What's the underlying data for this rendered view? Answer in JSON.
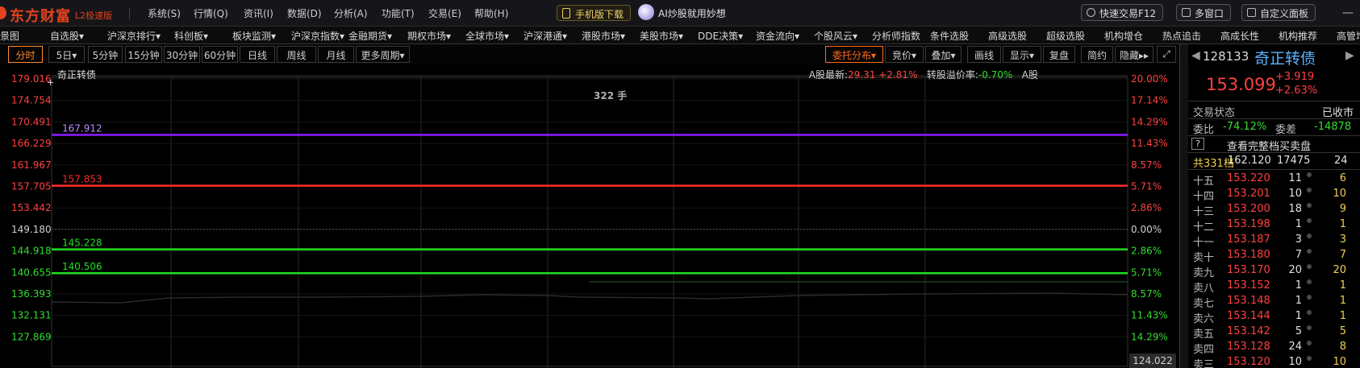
{
  "app": {
    "brand": "东方财富",
    "edition": "L2极速版",
    "menus": [
      "系统(S)",
      "行情(Q)",
      "资讯(I)",
      "数据(D)",
      "分析(A)",
      "功能(T)",
      "交易(E)",
      "帮助(H)"
    ],
    "mobile_download": "手机版下载",
    "ai_slogan": "AI炒股就用妙想",
    "quick_trade": "快速交易F12",
    "multi_window": "多窗口",
    "custom_panel": "自定义面板"
  },
  "nav": {
    "items": [
      "全景图",
      "自选股",
      "沪深京排行",
      "科创板",
      "板块监测",
      "沪深京指数",
      "金融期货",
      "期权市场",
      "全球市场",
      "沪深港通",
      "港股市场",
      "美股市场",
      "DDE决策",
      "资金流向",
      "个股风云",
      "分析师指数",
      "条件选股",
      "高级选股",
      "超级选股",
      "机构增仓",
      "热点追击",
      "高成长性",
      "机构推荐",
      "高管增持"
    ],
    "dropdown_marker": "▾"
  },
  "toolbar": {
    "periods": [
      "分时",
      "5日",
      "5分钟",
      "15分钟",
      "30分钟",
      "60分钟",
      "日线",
      "周线",
      "月线",
      "更多周期"
    ],
    "active_period": "分时",
    "right_buttons": [
      "委托分布",
      "竞价",
      "叠加",
      "画线",
      "显示",
      "复盘",
      "简约",
      "隐藏"
    ]
  },
  "chart": {
    "stock_name": "奇正转债",
    "a_share_last_label": "A股最新:",
    "a_share_last": "29.31",
    "a_share_change": "+2.81%",
    "premium_label": "转股溢价率:",
    "premium": "-0.70%",
    "a_share_tag": "A股",
    "volume_label": "322 手",
    "bottom_price": "124.022",
    "left_axis": [
      "179.016",
      "174.754",
      "170.491",
      "166.229",
      "161.967",
      "157.705",
      "153.442",
      "149.180",
      "144.918",
      "140.655",
      "136.393",
      "132.131",
      "127.869"
    ],
    "right_axis": [
      "20.00%",
      "17.14%",
      "14.29%",
      "11.43%",
      "8.57%",
      "5.71%",
      "2.86%",
      "0.00%",
      "2.86%",
      "5.71%",
      "8.57%",
      "11.43%",
      "14.29%"
    ],
    "lines": [
      {
        "label": "167.912",
        "value": 167.912,
        "color": "#8c1cff"
      },
      {
        "label": "157.853",
        "value": 157.853,
        "color": "#ff2a2a"
      },
      {
        "label": "145.228",
        "value": 145.228,
        "color": "#22dd22"
      },
      {
        "label": "140.506",
        "value": 140.506,
        "color": "#22dd22"
      }
    ],
    "colors": {
      "up": "#ff4040",
      "down": "#33dd33",
      "neutral": "#cfcfcf",
      "grid": "#2a2a2a",
      "accent": "#ff6a1a"
    }
  },
  "quote": {
    "code": "128133",
    "name": "奇正转债",
    "price": "153.099",
    "change": "+3.919",
    "change_pct": "+2.63%",
    "trade_status_label": "交易状态",
    "trade_status": "已收市",
    "wei_bi_label": "委比",
    "wei_bi": "-74.12%",
    "wei_cha_label": "委差",
    "wei_cha": "-14878",
    "help_mark": "?",
    "full_book_link": "查看完整档买卖盘",
    "total_label": "共331档",
    "total_price": "162.120",
    "total_volume": "17475",
    "total_orders": "24",
    "levels": [
      {
        "label": "十五",
        "price": "153.220",
        "vol": "11",
        "cnt": "6"
      },
      {
        "label": "十四",
        "price": "153.201",
        "vol": "10",
        "cnt": "10"
      },
      {
        "label": "十三",
        "price": "153.200",
        "vol": "18",
        "cnt": "9"
      },
      {
        "label": "十二",
        "price": "153.198",
        "vol": "1",
        "cnt": "1"
      },
      {
        "label": "十一",
        "price": "153.187",
        "vol": "3",
        "cnt": "3"
      },
      {
        "label": "卖十",
        "price": "153.180",
        "vol": "7",
        "cnt": "7"
      },
      {
        "label": "卖九",
        "price": "153.170",
        "vol": "20",
        "cnt": "20"
      },
      {
        "label": "卖八",
        "price": "153.152",
        "vol": "1",
        "cnt": "1"
      },
      {
        "label": "卖七",
        "price": "153.148",
        "vol": "1",
        "cnt": "1"
      },
      {
        "label": "卖六",
        "price": "153.144",
        "vol": "1",
        "cnt": "1"
      },
      {
        "label": "卖五",
        "price": "153.142",
        "vol": "5",
        "cnt": "5"
      },
      {
        "label": "卖四",
        "price": "153.128",
        "vol": "24",
        "cnt": "8"
      },
      {
        "label": "卖三",
        "price": "153.120",
        "vol": "10",
        "cnt": "10"
      }
    ]
  }
}
